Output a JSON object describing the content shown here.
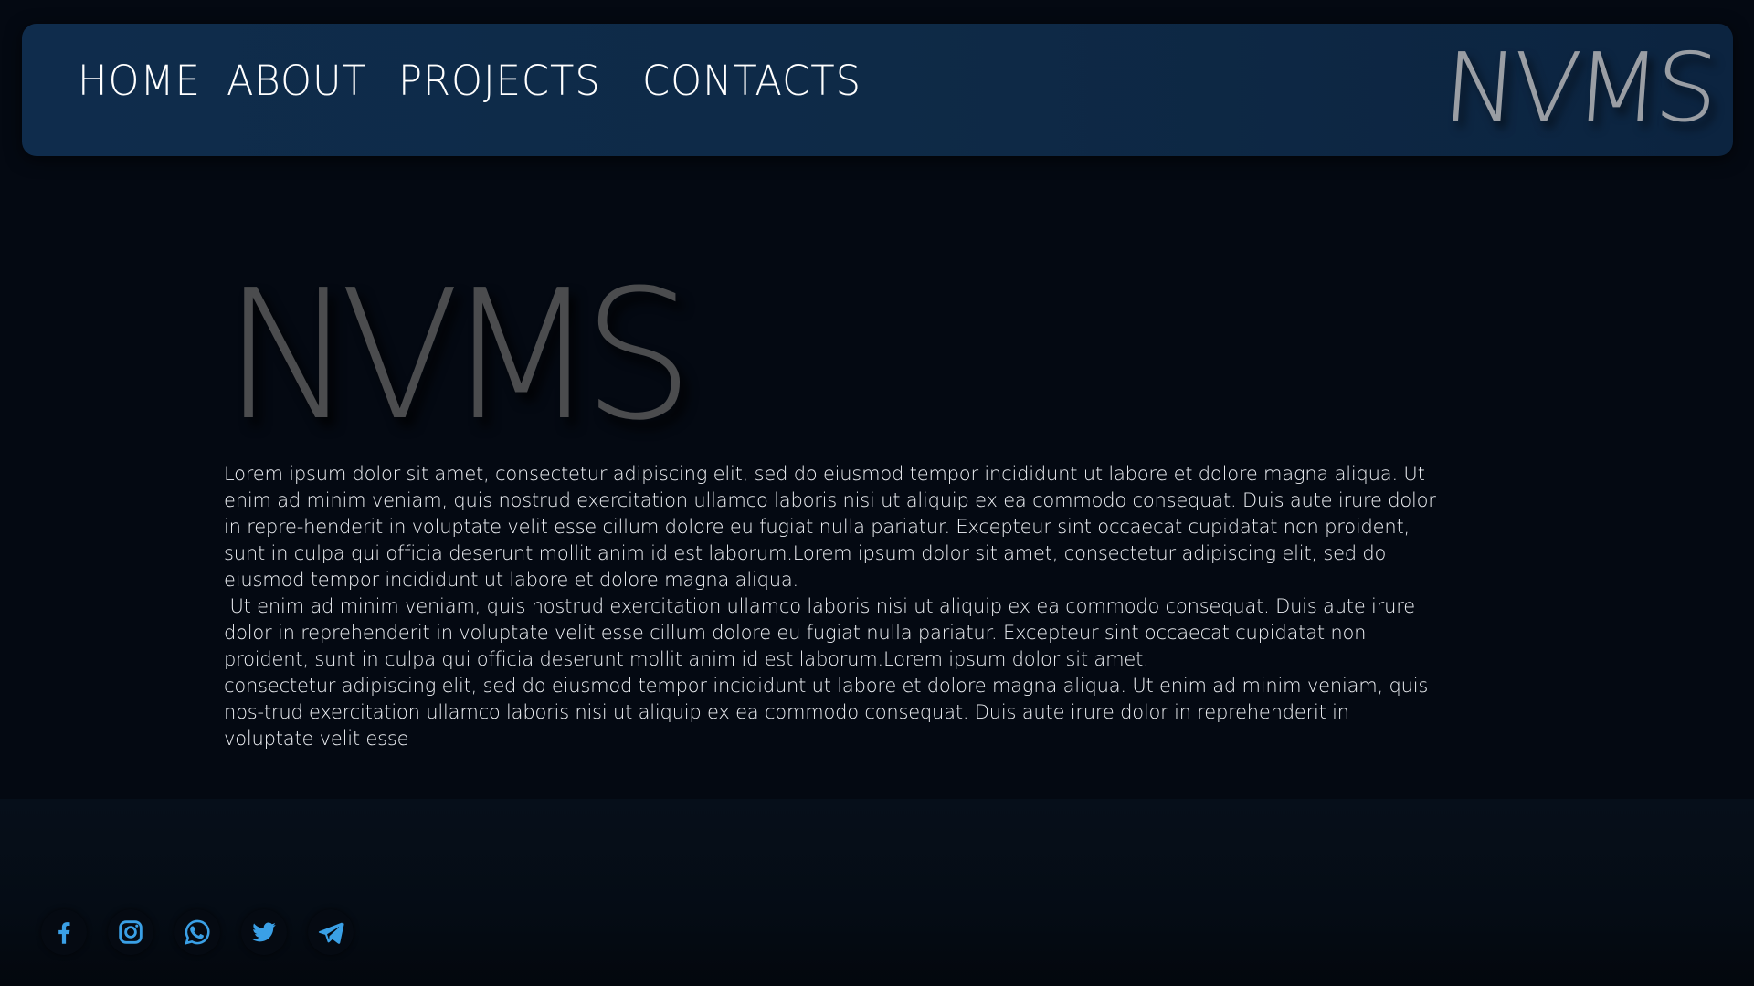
{
  "nav": {
    "home": "HOME",
    "about": "ABOUT",
    "projects": "PROJECTS",
    "contacts": "CONTACTS",
    "logo": "NVMS"
  },
  "main": {
    "logo": "NVMS",
    "paragraphs": [
      "Lorem ipsum dolor sit amet, consectetur adipiscing elit, sed do eiusmod tempor incididunt ut labore et dolore magna aliqua. Ut enim ad minim veniam, quis nostrud exercitation ullamco laboris nisi ut aliquip ex ea commodo consequat. Duis aute irure dolor in repre-henderit in voluptate velit esse cillum dolore eu fugiat nulla pariatur. Excepteur sint occaecat cupidatat non proident, sunt in culpa qui officia deserunt mollit anim id est laborum.Lorem ipsum dolor sit amet, consectetur adipiscing elit, sed do eiusmod tempor incididunt ut labore et dolore magna aliqua.",
      " Ut enim ad minim veniam, quis nostrud exercitation ullamco laboris nisi ut aliquip ex ea commodo consequat. Duis aute irure dolor in reprehenderit in voluptate velit esse cillum dolore eu fugiat nulla pariatur. Excepteur sint occaecat cupidatat non proident, sunt in culpa qui officia deserunt mollit anim id est laborum.Lorem ipsum dolor sit amet.",
      "consectetur adipiscing elit, sed do eiusmod tempor incididunt ut labore et dolore magna aliqua. Ut enim ad minim veniam, quis nos-trud exercitation ullamco laboris nisi ut aliquip ex ea commodo consequat. Duis aute irure dolor in reprehenderit in voluptate velit esse"
    ]
  },
  "footer": {
    "social_icons": [
      "facebook-icon",
      "instagram-icon",
      "whatsapp-icon",
      "twitter-icon",
      "telegram-icon"
    ]
  },
  "colors": {
    "background": "#040912",
    "navbar": "#0e2a47",
    "icon_accent": "#3aa0e6",
    "hero_logo": "#4b4c4e",
    "nav_logo": "#9a9ea4"
  }
}
